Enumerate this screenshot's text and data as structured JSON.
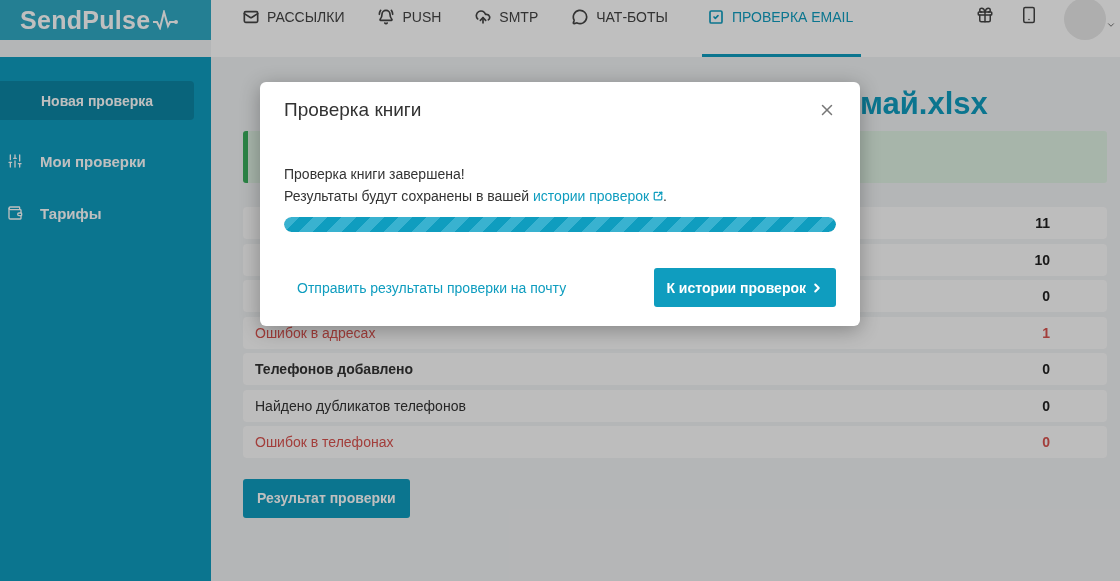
{
  "brand": "SendPulse",
  "nav": [
    {
      "label": "РАССЫЛКИ",
      "selected": false
    },
    {
      "label": "PUSH",
      "selected": false
    },
    {
      "label": "SMTP",
      "selected": false
    },
    {
      "label": "ЧАТ-БОТЫ",
      "selected": false
    },
    {
      "label": "ПРОВЕРКА EMAIL",
      "selected": true
    }
  ],
  "sidebar": {
    "primary_button": "Новая проверка",
    "items": [
      {
        "label": "Мои проверки"
      },
      {
        "label": "Тарифы"
      }
    ]
  },
  "page": {
    "title_end": "май.xlsx",
    "rows": [
      {
        "value": "11",
        "kind": "normal"
      },
      {
        "value": "10",
        "kind": "bold"
      },
      {
        "value": "0",
        "kind": "normal"
      },
      {
        "label": "Ошибок в адресах",
        "value": "1",
        "kind": "error"
      },
      {
        "label": "Телефонов добавлено",
        "value": "0",
        "kind": "bold"
      },
      {
        "label": "Найдено дубликатов телефонов",
        "value": "0",
        "kind": "normal"
      },
      {
        "label": "Ошибок в телефонах",
        "value": "0",
        "kind": "error"
      }
    ],
    "result_button": "Результат проверки"
  },
  "dialog": {
    "title": "Проверка книги",
    "message": "Проверка книги завершена!",
    "note": "Результаты будут сохранены в вашей ",
    "note_link": "истории проверок",
    "note_end": ".",
    "progress": {
      "level": 1
    },
    "email_link": "Отправить результаты проверки на почту",
    "primary_button": "К истории проверок"
  }
}
